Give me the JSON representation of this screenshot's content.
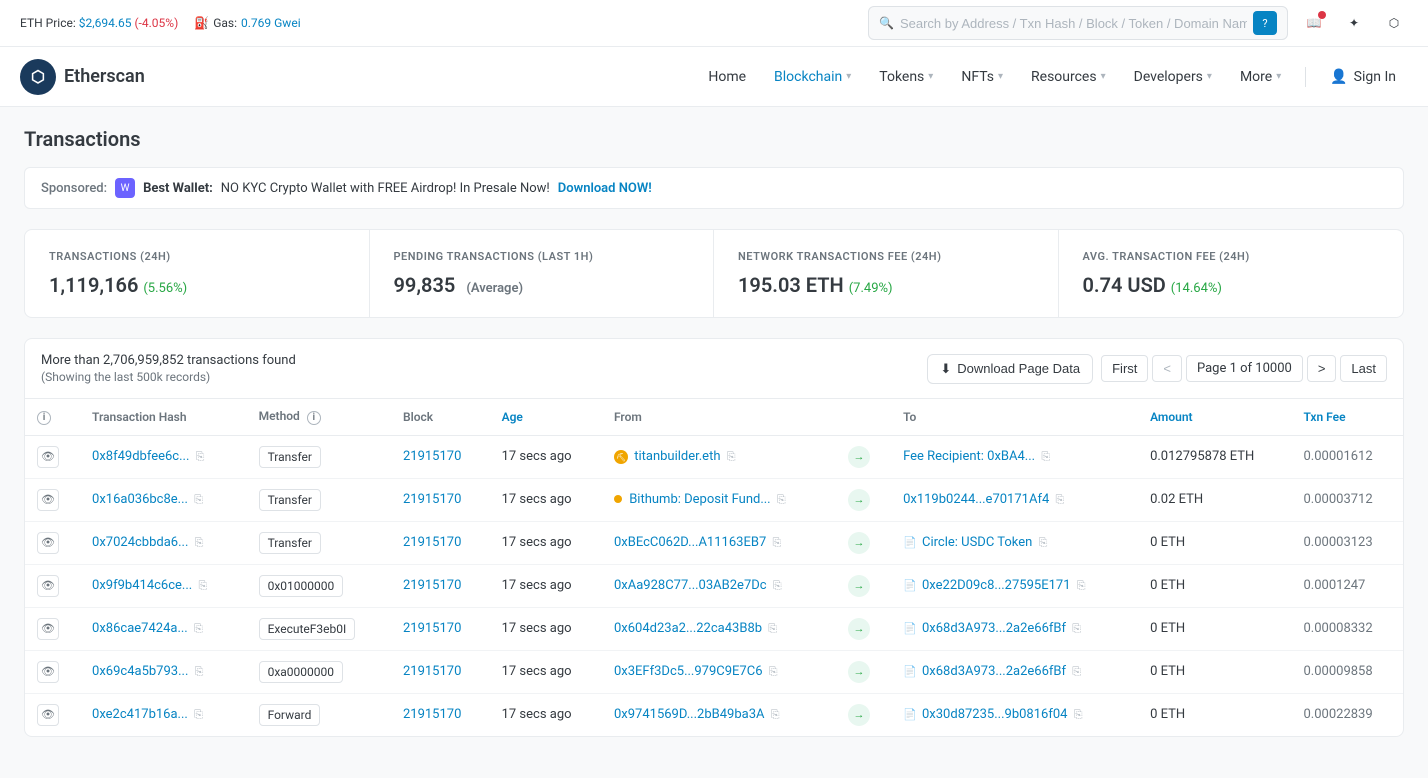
{
  "topbar": {
    "eth_price_label": "ETH Price:",
    "eth_price_value": "$2,694.65",
    "eth_price_change": "(-4.05%)",
    "gas_label": "Gas:",
    "gas_value": "0.769 Gwei",
    "search_placeholder": "Search by Address / Txn Hash / Block / Token / Domain Name"
  },
  "navbar": {
    "logo_text": "Etherscan",
    "home": "Home",
    "blockchain": "Blockchain",
    "tokens": "Tokens",
    "nfts": "NFTs",
    "resources": "Resources",
    "developers": "Developers",
    "more": "More",
    "sign_in": "Sign In"
  },
  "page": {
    "title": "Transactions"
  },
  "sponsored": {
    "label": "Sponsored:",
    "wallet_name": "Best Wallet:",
    "text": "NO KYC Crypto Wallet with FREE Airdrop! In Presale Now!",
    "link_text": "Download NOW!"
  },
  "stats": {
    "transactions_24h": {
      "label": "TRANSACTIONS (24H)",
      "value": "1,119,166",
      "change": "(5.56%)",
      "change_type": "pos"
    },
    "pending": {
      "label": "PENDING TRANSACTIONS (LAST 1H)",
      "value": "99,835",
      "sub": "(Average)"
    },
    "network_fee": {
      "label": "NETWORK TRANSACTIONS FEE (24H)",
      "value": "195.03 ETH",
      "change": "(7.49%)",
      "change_type": "pos"
    },
    "avg_fee": {
      "label": "AVG. TRANSACTION FEE (24H)",
      "value": "0.74 USD",
      "change": "(14.64%)",
      "change_type": "pos"
    }
  },
  "table": {
    "found_text": "More than 2,706,959,852 transactions found",
    "showing_text": "(Showing the last 500k records)",
    "download_label": "Download Page Data",
    "pagination": {
      "first": "First",
      "prev": "<",
      "page_info": "Page 1 of 10000",
      "next": ">",
      "last": "Last"
    },
    "columns": {
      "info": "",
      "hash": "Transaction Hash",
      "method": "Method",
      "block": "Block",
      "age": "Age",
      "from": "From",
      "arrow": "",
      "to": "To",
      "amount": "Amount",
      "fee": "Txn Fee"
    },
    "rows": [
      {
        "hash": "0x8f49dbfee6c...",
        "method": "Transfer",
        "block": "21915170",
        "age": "17 secs ago",
        "from": "titanbuilder.eth",
        "from_icon": "builder",
        "to": "Fee Recipient: 0xBA4...",
        "amount": "0.012795878 ETH",
        "fee": "0.00001612"
      },
      {
        "hash": "0x16a036bc8e...",
        "method": "Transfer",
        "block": "21915170",
        "age": "17 secs ago",
        "from": "Bithumb: Deposit Fund...",
        "from_icon": "dot",
        "to": "0x119b0244...e70171Af4",
        "amount": "0.02 ETH",
        "fee": "0.00003712"
      },
      {
        "hash": "0x7024cbbda6...",
        "method": "Transfer",
        "block": "21915170",
        "age": "17 secs ago",
        "from": "0xBEcC062D...A11163EB7",
        "from_icon": null,
        "to": "Circle: USDC Token",
        "to_contract": true,
        "amount": "0 ETH",
        "fee": "0.00003123"
      },
      {
        "hash": "0x9f9b414c6ce...",
        "method": "0x01000000",
        "block": "21915170",
        "age": "17 secs ago",
        "from": "0xAa928C77...03AB2e7Dc",
        "from_icon": null,
        "to": "0xe22D09c8...27595E171",
        "to_contract": true,
        "amount": "0 ETH",
        "fee": "0.0001247"
      },
      {
        "hash": "0x86cae7424a...",
        "method": "ExecuteF3eb0I",
        "block": "21915170",
        "age": "17 secs ago",
        "from": "0x604d23a2...22ca43B8b",
        "from_icon": null,
        "to": "0x68d3A973...2a2e66fBf",
        "to_contract": true,
        "amount": "0 ETH",
        "fee": "0.00008332"
      },
      {
        "hash": "0x69c4a5b793...",
        "method": "0xa0000000",
        "block": "21915170",
        "age": "17 secs ago",
        "from": "0x3EFf3Dc5...979C9E7C6",
        "from_icon": null,
        "to": "0x68d3A973...2a2e66fBf",
        "to_contract": true,
        "amount": "0 ETH",
        "fee": "0.00009858"
      },
      {
        "hash": "0xe2c417b16a...",
        "method": "Forward",
        "block": "21915170",
        "age": "17 secs ago",
        "from": "0x9741569D...2bB49ba3A",
        "from_icon": null,
        "to": "0x30d87235...9b0816f04",
        "to_contract": true,
        "amount": "0 ETH",
        "fee": "0.00022839"
      }
    ]
  }
}
